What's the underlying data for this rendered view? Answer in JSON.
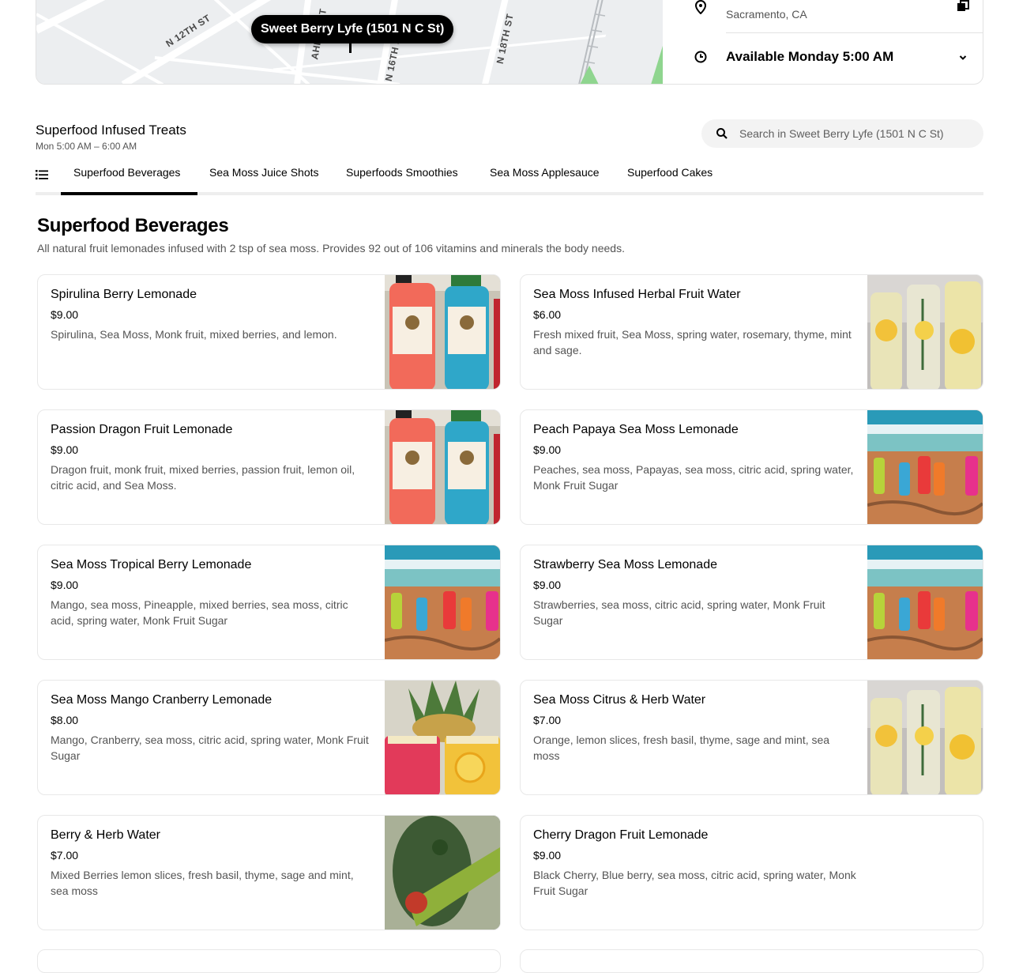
{
  "store": {
    "map_pin_label": "Sweet Berry Lyfe (1501 N C St)",
    "streets": [
      "N 12TH ST",
      "AHERN ST",
      "N 16TH ST",
      "N 18TH ST"
    ],
    "city": "Sacramento, CA",
    "availability": "Available Monday 5:00 AM"
  },
  "menu": {
    "title": "Superfood Infused Treats",
    "hours": "Mon 5:00 AM – 6:00 AM"
  },
  "search": {
    "placeholder": "Search in Sweet Berry Lyfe (1501 N C St)"
  },
  "tabs": [
    {
      "label": "Superfood Beverages",
      "active": true
    },
    {
      "label": "Sea Moss Juice Shots",
      "active": false
    },
    {
      "label": "Superfoods Smoothies",
      "active": false
    },
    {
      "label": "Sea Moss Applesauce",
      "active": false
    },
    {
      "label": "Superfood Cakes",
      "active": false
    }
  ],
  "section": {
    "title": "Superfood Beverages",
    "description": "All natural fruit lemonades infused with 2 tsp of sea moss. Provides 92 out of 106 vitamins and minerals the body needs."
  },
  "items": [
    {
      "name": "Spirulina Berry Lemonade",
      "price": "$9.00",
      "description": "Spirulina, Sea Moss, Monk fruit, mixed berries, and lemon.",
      "image": "red-blue-bottles"
    },
    {
      "name": "Sea Moss Infused Herbal Fruit Water",
      "price": "$6.00",
      "description": "Fresh mixed fruit, Sea Moss, spring water, rosemary, thyme, mint and sage.",
      "image": "herb-water-bottles"
    },
    {
      "name": "Passion Dragon Fruit Lemonade",
      "price": "$9.00",
      "description": "Dragon fruit, monk fruit, mixed berries, passion fruit, lemon oil, citric acid, and Sea Moss.",
      "image": "red-blue-bottles"
    },
    {
      "name": "Peach Papaya Sea Moss Lemonade",
      "price": "$9.00",
      "description": "Peaches, sea moss, Papayas, sea moss, citric acid, spring water, Monk Fruit Sugar",
      "image": "beach-bottles"
    },
    {
      "name": "Sea Moss Tropical Berry Lemonade",
      "price": "$9.00",
      "description": "Mango, sea moss, Pineapple, mixed berries, sea moss, citric acid, spring water, Monk Fruit Sugar",
      "image": "beach-bottles"
    },
    {
      "name": "Strawberry Sea Moss Lemonade",
      "price": "$9.00",
      "description": "Strawberries, sea moss, citric acid, spring water, Monk Fruit Sugar",
      "image": "beach-bottles"
    },
    {
      "name": "Sea Moss Mango Cranberry Lemonade",
      "price": "$8.00",
      "description": "Mango, Cranberry, sea moss, citric acid, spring water, Monk Fruit Sugar",
      "image": "fruit-jars"
    },
    {
      "name": "Sea Moss Citrus & Herb Water",
      "price": "$7.00",
      "description": "Orange, lemon slices, fresh basil, thyme, sage and mint, sea moss",
      "image": "herb-water-bottles"
    },
    {
      "name": "Berry & Herb Water",
      "price": "$7.00",
      "description": "Mixed Berries lemon slices, fresh basil, thyme, sage and mint, sea moss",
      "image": "green-label-bottle"
    },
    {
      "name": "Cherry Dragon Fruit Lemonade",
      "price": "$9.00",
      "description": "Black Cherry, Blue berry, sea moss, citric acid, spring water, Monk Fruit Sugar",
      "image": ""
    }
  ]
}
